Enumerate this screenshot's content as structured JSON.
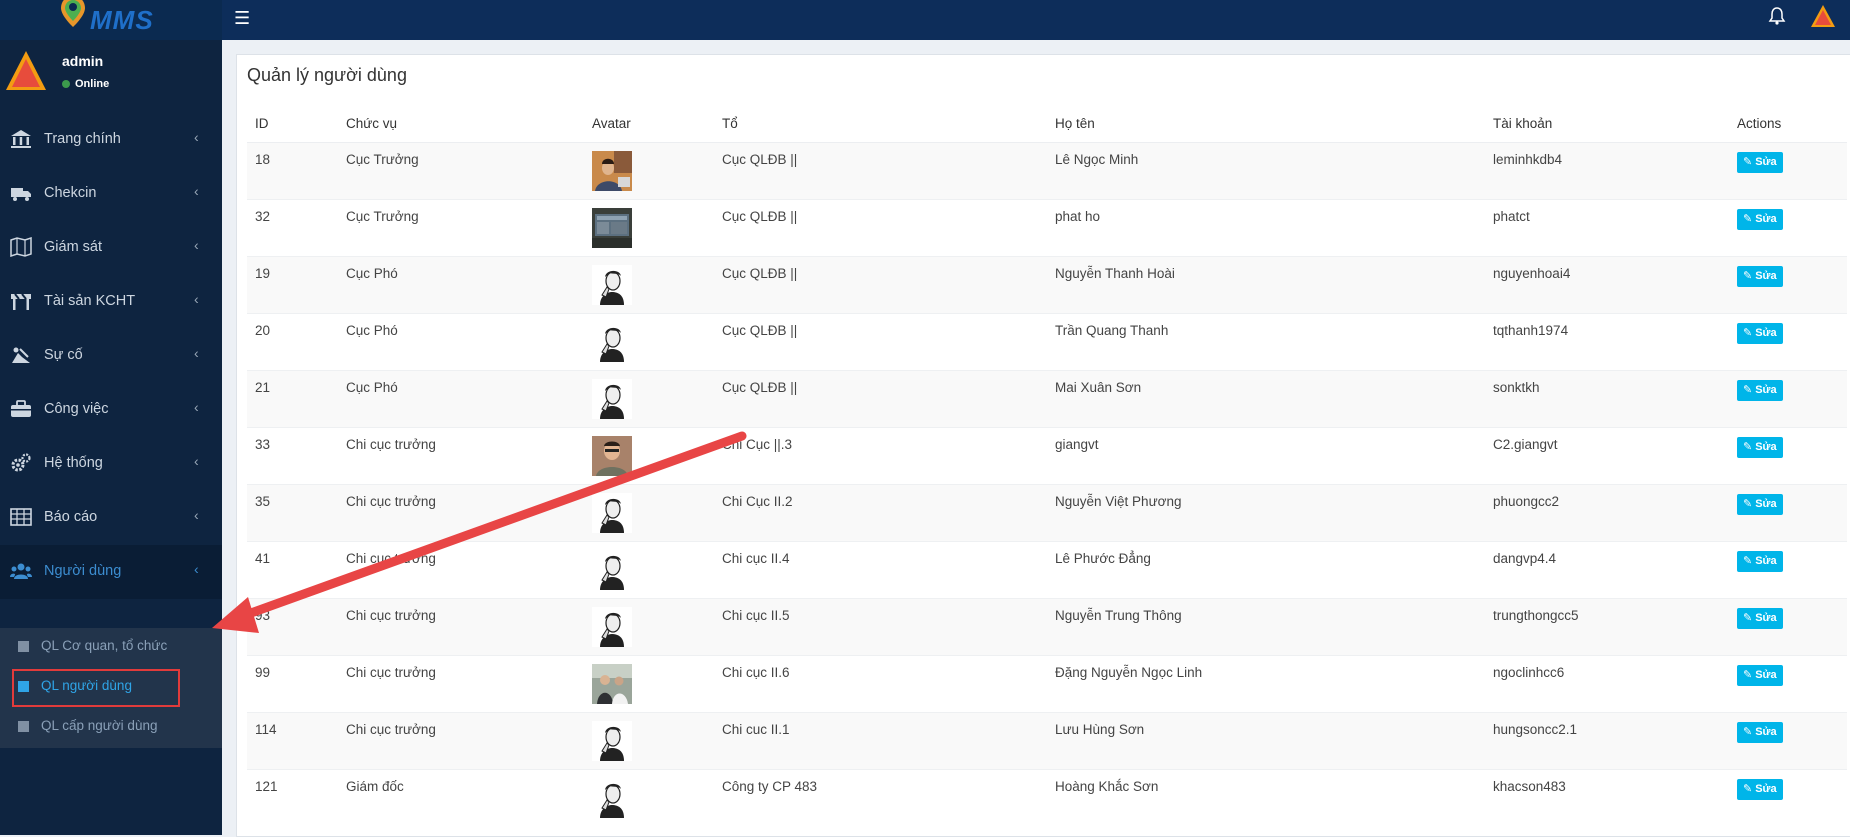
{
  "header": {
    "logo_text": "MMS",
    "menu_icon": "hamburger-icon",
    "notification_icon": "bell-icon",
    "accent": "#0d2d5a"
  },
  "sidebar": {
    "user": {
      "name": "admin",
      "status": "Online"
    },
    "items": [
      {
        "label": "Trang chính",
        "icon": "bank-icon"
      },
      {
        "label": "Chekcin",
        "icon": "truck-icon"
      },
      {
        "label": "Giám sát",
        "icon": "map-icon"
      },
      {
        "label": "Tài sản KCHT",
        "icon": "road-barrier-icon"
      },
      {
        "label": "Sự cố",
        "icon": "warning-icon"
      },
      {
        "label": "Công việc",
        "icon": "briefcase-icon"
      },
      {
        "label": "Hệ thống",
        "icon": "gears-icon"
      },
      {
        "label": "Báo cáo",
        "icon": "table-icon"
      },
      {
        "label": "Người dùng",
        "icon": "users-icon",
        "active": true
      }
    ],
    "submenu": [
      {
        "label": "QL Cơ quan, tổ chức"
      },
      {
        "label": "QL người dùng",
        "active": true
      },
      {
        "label": "QL cấp người dùng"
      }
    ]
  },
  "main": {
    "title": "Quản lý người dùng",
    "columns": [
      "ID",
      "Chức vụ",
      "Avatar",
      "Tổ",
      "Họ tên",
      "Tài khoản",
      "Actions"
    ],
    "edit_label": "Sửa",
    "rows": [
      {
        "id": "18",
        "position": "Cục Trưởng",
        "avatar": "photo-portrait",
        "team": "Cục QLĐB ||",
        "name": "Lê Ngọc Minh",
        "account": "leminhkdb4"
      },
      {
        "id": "32",
        "position": "Cục Trưởng",
        "avatar": "photo-screen",
        "team": "Cục QLĐB ||",
        "name": "phat ho",
        "account": "phatct"
      },
      {
        "id": "19",
        "position": "Cục Phó",
        "avatar": "default-sketch",
        "team": "Cục QLĐB ||",
        "name": "Nguyễn Thanh Hoài",
        "account": "nguyenhoai4"
      },
      {
        "id": "20",
        "position": "Cục Phó",
        "avatar": "default-sketch",
        "team": "Cục QLĐB ||",
        "name": "Trần Quang Thanh",
        "account": "tqthanh1974"
      },
      {
        "id": "21",
        "position": "Cục Phó",
        "avatar": "default-sketch",
        "team": "Cục QLĐB ||",
        "name": "Mai Xuân Sơn",
        "account": "sonktkh"
      },
      {
        "id": "33",
        "position": "Chi cục trưởng",
        "avatar": "photo-person",
        "team": "Chi Cục ||.3",
        "name": "giangvt",
        "account": "C2.giangvt"
      },
      {
        "id": "35",
        "position": "Chi cục trưởng",
        "avatar": "default-sketch",
        "team": "Chi Cục II.2",
        "name": "Nguyễn Việt Phương",
        "account": "phuongcc2"
      },
      {
        "id": "41",
        "position": "Chi cục trưởng",
        "avatar": "default-sketch",
        "team": "Chi cục II.4",
        "name": "Lê Phước Đẳng",
        "account": "dangvp4.4"
      },
      {
        "id": "93",
        "position": "Chi cục trưởng",
        "avatar": "default-sketch",
        "team": "Chi cục II.5",
        "name": "Nguyễn Trung Thông",
        "account": "trungthongcc5"
      },
      {
        "id": "99",
        "position": "Chi cục trưởng",
        "avatar": "photo-group",
        "team": "Chi cục II.6",
        "name": "Đặng Nguyễn Ngọc Linh",
        "account": "ngoclinhcc6"
      },
      {
        "id": "114",
        "position": "Chi cục trưởng",
        "avatar": "default-sketch",
        "team": "Chi cuc II.1",
        "name": "Lưu Hùng Sơn",
        "account": "hungsoncc2.1"
      },
      {
        "id": "121",
        "position": "Giám đốc",
        "avatar": "default-sketch",
        "team": "Công ty CP 483",
        "name": "Hoàng Khắc Sơn",
        "account": "khacson483"
      }
    ]
  },
  "annotation": {
    "arrow_color": "#e84545",
    "highlight_color": "#e23b3b"
  }
}
